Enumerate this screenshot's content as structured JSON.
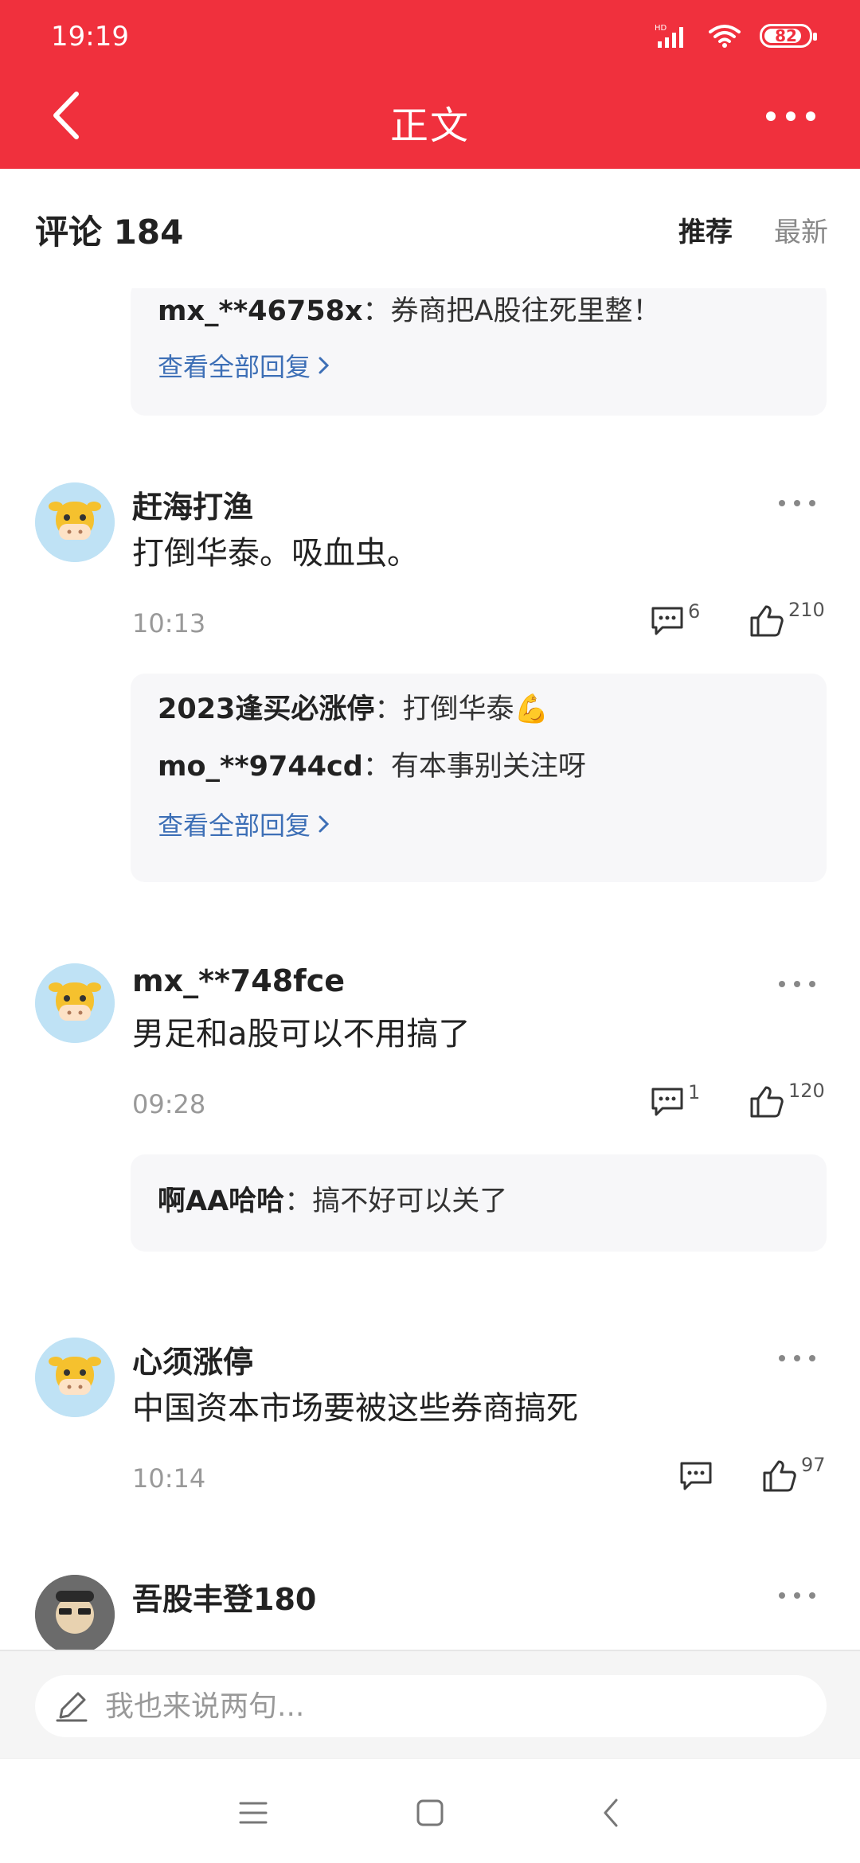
{
  "status": {
    "time": "19:19",
    "battery": "82",
    "network_badge": "HD"
  },
  "header": {
    "title": "正文",
    "back_icon": "chevron-left-icon",
    "more_icon": "more-horizontal-icon"
  },
  "comments_header": {
    "title": "评论 184",
    "sort_recommend": "推荐",
    "sort_latest": "最新"
  },
  "top_reply_box": {
    "replies": [
      {
        "user": "mx_**46758x",
        "text": "券商把A股往死里整！"
      }
    ],
    "view_all": "查看全部回复"
  },
  "comments": [
    {
      "user": "赶海打渔",
      "content": "打倒华泰。吸血虫。",
      "time": "10:13",
      "reply_count": "6",
      "like_count": "210",
      "replies": [
        {
          "user": "2023逢买必涨停",
          "text": "打倒华泰💪"
        },
        {
          "user": "mo_**9744cd",
          "text": "有本事别关注呀"
        }
      ],
      "view_all": "查看全部回复"
    },
    {
      "user": "mx_**748fce",
      "content": "男足和a股可以不用搞了",
      "time": "09:28",
      "reply_count": "1",
      "like_count": "120",
      "replies": [
        {
          "user": "啊AA哈哈",
          "text": "搞不好可以关了"
        }
      ]
    },
    {
      "user": "心须涨停",
      "content": "中国资本市场要被这些券商搞死",
      "time": "10:14",
      "reply_count": "",
      "like_count": "97"
    },
    {
      "user": "吾股丰登180"
    }
  ],
  "input": {
    "placeholder": "我也来说两句..."
  },
  "colors": {
    "brand_red": "#f0303d",
    "link_blue": "#3d6fb6",
    "reply_bg": "#f7f7f9"
  }
}
